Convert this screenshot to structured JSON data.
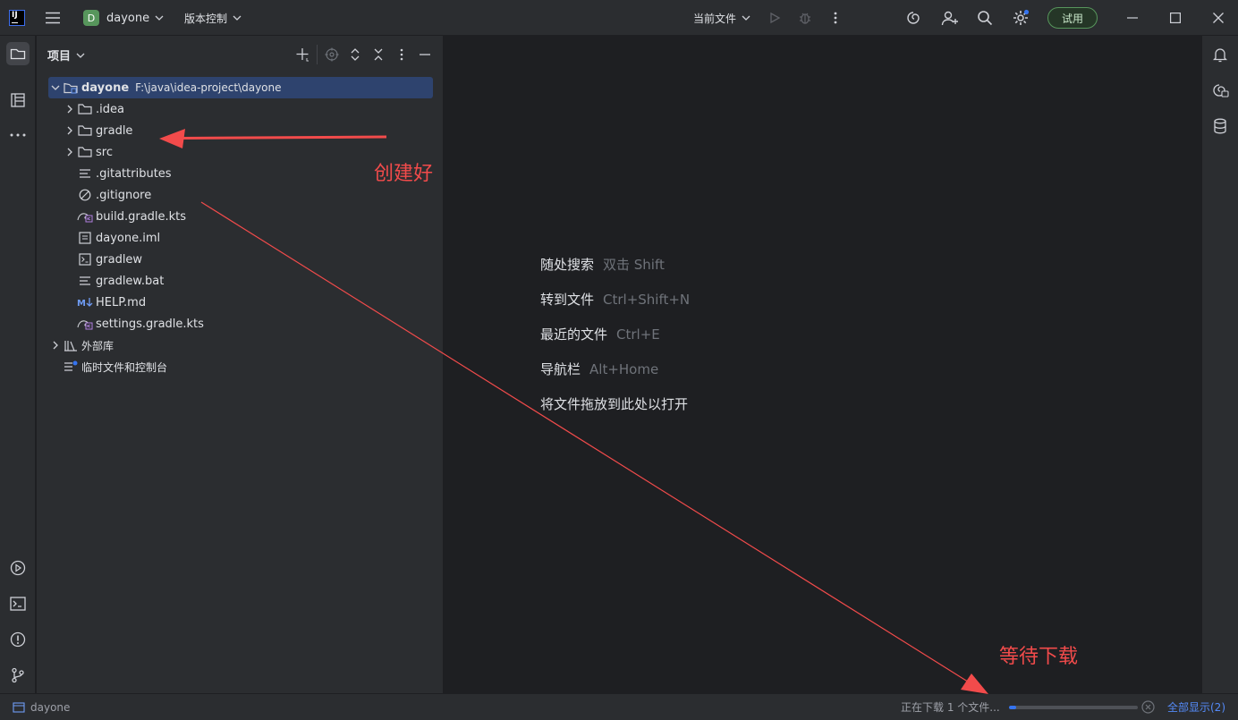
{
  "window": {
    "logo_text": "IJ",
    "project_badge": "D",
    "project_name": "dayone",
    "vcs_label": "版本控制",
    "run_config": "当前文件",
    "trial_label": "试用",
    "accent_color": "#3574f0",
    "trial_color": "#57965c"
  },
  "project_panel": {
    "title": "项目",
    "root": {
      "name": "dayone",
      "path": "F:\\java\\idea-project\\dayone"
    },
    "items": [
      {
        "name": ".idea",
        "icon": "folder-icon"
      },
      {
        "name": "gradle",
        "icon": "folder-icon"
      },
      {
        "name": "src",
        "icon": "folder-icon"
      },
      {
        "name": ".gitattributes",
        "icon": "text-file-icon"
      },
      {
        "name": ".gitignore",
        "icon": "ignore-file-icon"
      },
      {
        "name": "build.gradle.kts",
        "icon": "gradle-kts-icon"
      },
      {
        "name": "dayone.iml",
        "icon": "module-file-icon"
      },
      {
        "name": "gradlew",
        "icon": "shell-script-icon"
      },
      {
        "name": "gradlew.bat",
        "icon": "text-file-icon"
      },
      {
        "name": "HELP.md",
        "icon": "markdown-icon"
      },
      {
        "name": "settings.gradle.kts",
        "icon": "gradle-kts-icon"
      }
    ],
    "external_libs": "外部库",
    "scratches": "临时文件和控制台"
  },
  "editor_hints": [
    {
      "label": "随处搜索",
      "shortcut": "双击 Shift"
    },
    {
      "label": "转到文件",
      "shortcut": "Ctrl+Shift+N"
    },
    {
      "label": "最近的文件",
      "shortcut": "Ctrl+E"
    },
    {
      "label": "导航栏",
      "shortcut": "Alt+Home"
    },
    {
      "label": "将文件拖放到此处以打开",
      "shortcut": ""
    }
  ],
  "annotations": {
    "created": "创建好",
    "waiting": "等待下载"
  },
  "status_bar": {
    "project": "dayone",
    "download_text": "正在下载 1 个文件...",
    "download_progress": 0.06,
    "show_all": "全部显示(2)"
  }
}
